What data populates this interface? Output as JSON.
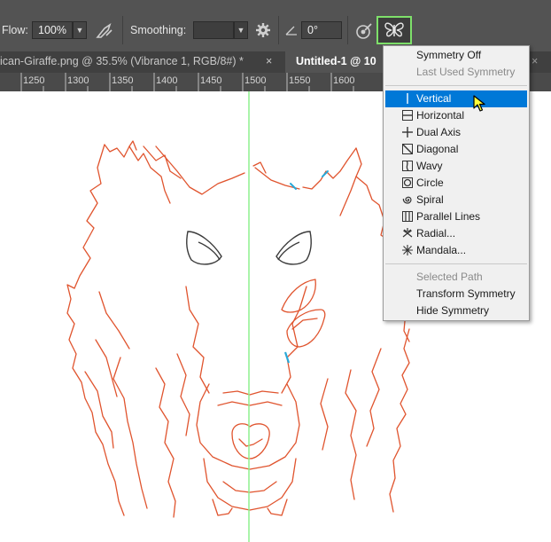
{
  "options_bar": {
    "flow_label": "Flow:",
    "flow_value": "100%",
    "smoothing_label": "Smoothing:",
    "smoothing_value": "",
    "angle_value": "0°"
  },
  "tabs": [
    {
      "label": "ican-Giraffe.png @ 35.5% (Vibrance 1, RGB/8#) *",
      "close": "×"
    },
    {
      "label": "Untitled-1 @ 10",
      "close": "×"
    }
  ],
  "ruler": {
    "ticks": [
      "1250",
      "1300",
      "1350",
      "1400",
      "1450",
      "1500",
      "1550",
      "1600"
    ]
  },
  "symmetry_menu": {
    "items": [
      {
        "label": "Symmetry Off",
        "icon": "none",
        "disabled": false
      },
      {
        "label": "Last Used Symmetry",
        "icon": "none",
        "disabled": true
      },
      {
        "label": "Vertical",
        "icon": "vertical-icon",
        "selected": true
      },
      {
        "label": "Horizontal",
        "icon": "horizontal-icon"
      },
      {
        "label": "Dual Axis",
        "icon": "dual-axis-icon"
      },
      {
        "label": "Diagonal",
        "icon": "diagonal-icon"
      },
      {
        "label": "Wavy",
        "icon": "wavy-icon"
      },
      {
        "label": "Circle",
        "icon": "circle-icon"
      },
      {
        "label": "Spiral",
        "icon": "spiral-icon"
      },
      {
        "label": "Parallel Lines",
        "icon": "parallel-lines-icon"
      },
      {
        "label": "Radial...",
        "icon": "radial-icon"
      },
      {
        "label": "Mandala...",
        "icon": "mandala-icon"
      },
      {
        "label": "Selected Path",
        "icon": "none",
        "disabled": true
      },
      {
        "label": "Transform Symmetry",
        "icon": "none"
      },
      {
        "label": "Hide Symmetry",
        "icon": "none"
      }
    ]
  },
  "colors": {
    "sketch_stroke": "#e0542e",
    "symmetry_axis": "#8ef08e",
    "menu_highlight": "#0078d7",
    "symmetry_button_border": "#7ee06a"
  }
}
